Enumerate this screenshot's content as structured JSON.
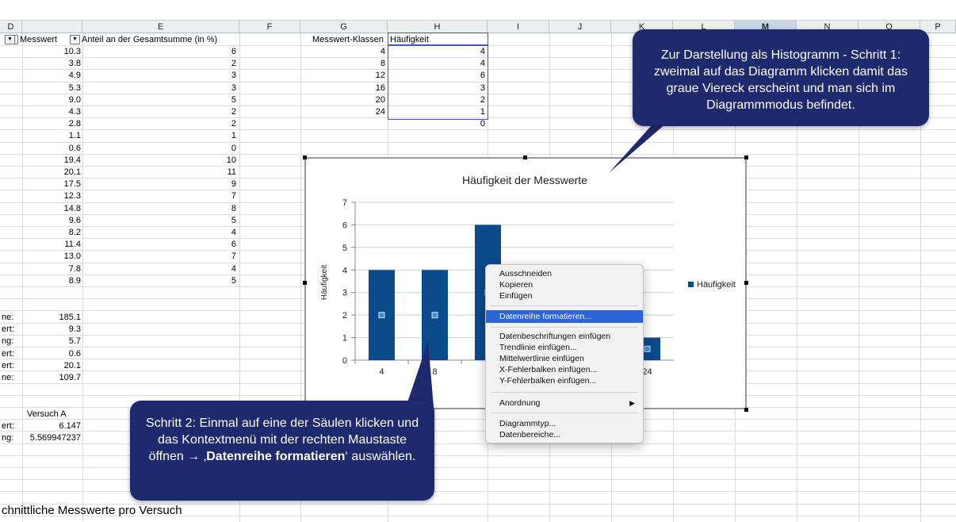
{
  "columns": [
    {
      "label": "D",
      "x": 0,
      "w": 28
    },
    {
      "label": "E",
      "x": 0,
      "w": 0
    }
  ],
  "col_headers": [
    "D",
    "E",
    "F",
    "G",
    "H",
    "I",
    "J",
    "K",
    "L",
    "M",
    "N",
    "O",
    "P"
  ],
  "header_row": {
    "d": "Messwert",
    "e": "Anteil an der Gesamtsumme (in %)",
    "g": "Messwert-Klassen",
    "h": "Häufigkeit"
  },
  "col_d_values": [
    "10.3",
    "3.8",
    "4.9",
    "5.3",
    "9.0",
    "4.3",
    "2.8",
    "1.1",
    "0.6",
    "19.4",
    "20.1",
    "17.5",
    "12.3",
    "14.8",
    "9.6",
    "8.2",
    "11.4",
    "13.0",
    "7.8",
    "8.9"
  ],
  "col_e_values": [
    "6",
    "2",
    "3",
    "3",
    "5",
    "2",
    "2",
    "1",
    "0",
    "10",
    "11",
    "9",
    "7",
    "8",
    "5",
    "4",
    "6",
    "7",
    "4",
    "5"
  ],
  "classes_g": [
    "4",
    "8",
    "12",
    "16",
    "20",
    "24"
  ],
  "freq_h": [
    "4",
    "4",
    "6",
    "3",
    "2",
    "1",
    "0"
  ],
  "stats_labels": [
    "ne:",
    "ert:",
    "ng:",
    "ert:",
    "ert:",
    "ne:"
  ],
  "stats_values": [
    "185.1",
    "9.3",
    "5.7",
    "0.6",
    "20.1",
    "109.7"
  ],
  "versuch": {
    "header": "Versuch A",
    "label1": "ert:",
    "value1": "6.147",
    "label2": "ng:",
    "value2": "5.569947237"
  },
  "bottom_text": "chnittliche Messwerte pro Versuch",
  "chart_data": {
    "type": "bar",
    "title": "Häufigkeit der Messwerte",
    "ylabel": "Häufigkeit",
    "xlabel": "",
    "categories": [
      "4",
      "8",
      "12",
      "16",
      "20",
      "24"
    ],
    "visible_tick_labels": [
      "4",
      "8",
      "1",
      "24"
    ],
    "series": [
      {
        "name": "Häufigkeit",
        "values": [
          4,
          4,
          6,
          3,
          2,
          1
        ]
      }
    ],
    "yticks": [
      "0",
      "1",
      "2",
      "3",
      "4",
      "5",
      "6",
      "7"
    ],
    "ylim": [
      0,
      7
    ],
    "legend_position": "right",
    "bar_color": "#0b4a8b"
  },
  "callout_top": "Zur Darstellung als Histogramm - Schritt 1: zweimal auf das Diagramm klicken damit das graue Viereck erscheint und man sich im Diagrammmodus befindet.",
  "callout_bottom": {
    "part1": "Schritt 2: Einmal auf eine der Säulen klicken und das Kontextmenü mit der rechten Maustaste öffnen → ‚",
    "bold": "Datenreihe formatieren",
    "part2": "‘ auswählen."
  },
  "context_menu": {
    "group1": [
      "Ausschneiden",
      "Kopieren",
      "Einfügen"
    ],
    "highlighted": "Datenreihe formatieren...",
    "group3": [
      "Datenbeschriftungen einfügen",
      "Trendlinie einfügen...",
      "Mittelwertlinie einfügen",
      "X-Fehlerbalken einfügen...",
      "Y-Fehlerbalken einfügen..."
    ],
    "submenu": "Anordnung",
    "submenu_arrow": "▶",
    "group5": [
      "Diagrammtyp...",
      "Datenbereiche..."
    ]
  },
  "filter_icon": "▼"
}
